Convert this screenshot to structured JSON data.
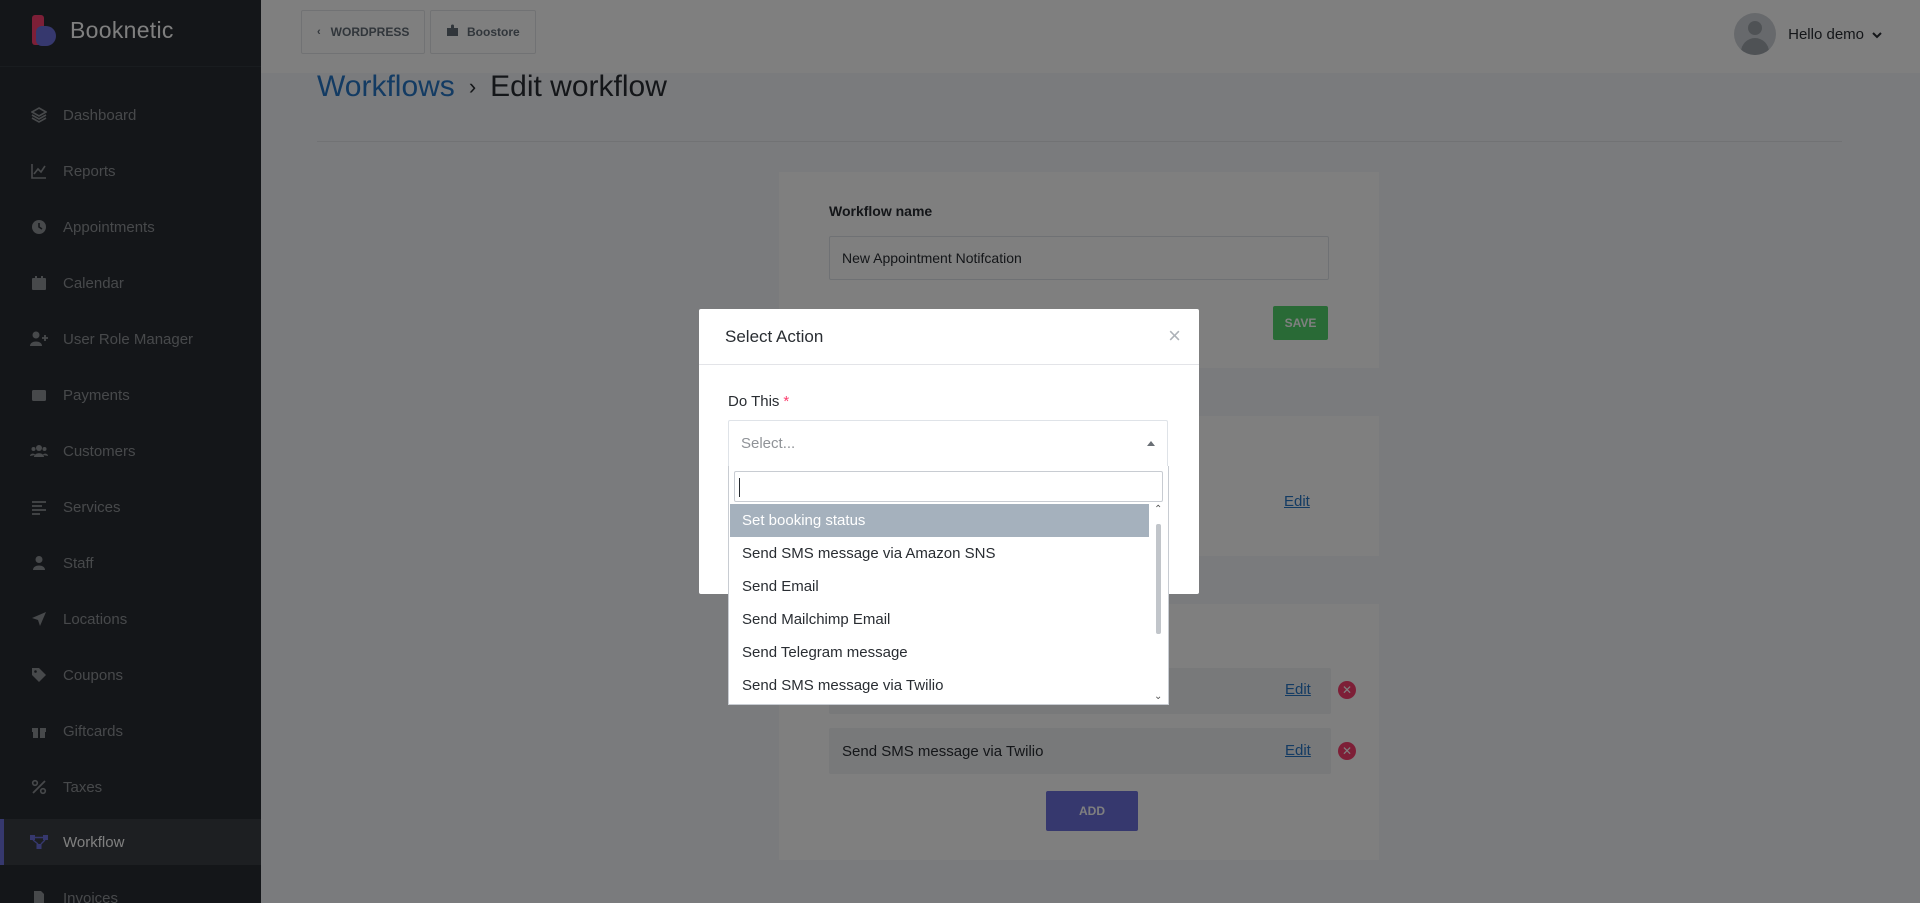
{
  "brand": {
    "name": "Booknetic"
  },
  "sidebar": {
    "items": [
      {
        "label": "Dashboard",
        "icon": "dashboard-icon"
      },
      {
        "label": "Reports",
        "icon": "chart-icon"
      },
      {
        "label": "Appointments",
        "icon": "clock-icon"
      },
      {
        "label": "Calendar",
        "icon": "calendar-icon"
      },
      {
        "label": "User Role Manager",
        "icon": "user-plus-icon"
      },
      {
        "label": "Payments",
        "icon": "wallet-icon"
      },
      {
        "label": "Customers",
        "icon": "users-icon"
      },
      {
        "label": "Services",
        "icon": "list-icon"
      },
      {
        "label": "Staff",
        "icon": "user-icon"
      },
      {
        "label": "Locations",
        "icon": "location-arrow-icon"
      },
      {
        "label": "Coupons",
        "icon": "tag-icon"
      },
      {
        "label": "Giftcards",
        "icon": "gift-icon"
      },
      {
        "label": "Taxes",
        "icon": "percent-icon"
      },
      {
        "label": "Workflow",
        "icon": "workflow-icon",
        "active": true
      },
      {
        "label": "Invoices",
        "icon": "invoice-icon"
      }
    ]
  },
  "topbar": {
    "wordpress_label": "WORDPRESS",
    "boostore_label": "Boostore",
    "user_greeting": "Hello demo"
  },
  "breadcrumb": {
    "parent": "Workflows",
    "separator": "›",
    "current": "Edit workflow"
  },
  "workflow": {
    "name_label": "Workflow name",
    "name_value": "New Appointment Notifcation",
    "save_label": "SAVE",
    "edit_label": "Edit",
    "actions": [
      {
        "label": "Send SMS message via Twilio"
      }
    ],
    "add_label": "ADD"
  },
  "modal": {
    "title": "Select Action",
    "close": "×",
    "field_label": "Do This",
    "required_mark": "*",
    "select_placeholder": "Select...",
    "options": [
      "Set booking status",
      "Send SMS message via Amazon SNS",
      "Send Email",
      "Send Mailchimp Email",
      "Send Telegram message",
      "Send SMS message via Twilio"
    ],
    "highlighted_index": 0
  },
  "colors": {
    "sidebar_bg": "#292d32",
    "accent": "#6c70dc",
    "save_green": "#53d56c",
    "danger": "#fb3e6e",
    "link": "#2776c6"
  }
}
